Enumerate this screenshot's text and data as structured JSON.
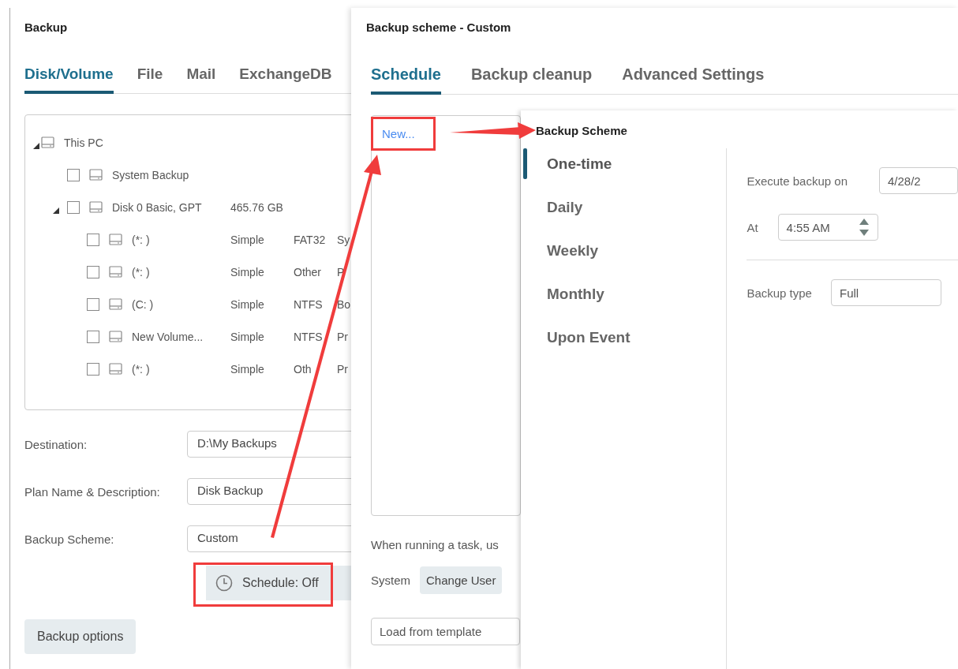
{
  "backup_window": {
    "title": "Backup",
    "tabs": [
      {
        "label": "Disk/Volume",
        "selected": true
      },
      {
        "label": "File",
        "selected": false
      },
      {
        "label": "Mail",
        "selected": false
      },
      {
        "label": "ExchangeDB",
        "selected": false
      }
    ],
    "tree": [
      {
        "cells": [
          "This PC"
        ],
        "expanded": true,
        "children": [
          {
            "cells": [
              "System Backup"
            ],
            "checked": false
          },
          {
            "cells": [
              "Disk 0 Basic, GPT",
              "465.76 GB"
            ],
            "checked": false,
            "expanded": true,
            "children": [
              {
                "cells": [
                  "(*: )",
                  "Simple",
                  "FAT32",
                  "Sy"
                ],
                "checked": false
              },
              {
                "cells": [
                  "(*: )",
                  "Simple",
                  "Other",
                  "P"
                ],
                "checked": false
              },
              {
                "cells": [
                  "(C: )",
                  "Simple",
                  "NTFS",
                  "Bo"
                ],
                "checked": false
              },
              {
                "cells": [
                  "New Volume...",
                  "Simple",
                  "NTFS",
                  "Pr"
                ],
                "checked": false
              },
              {
                "cells": [
                  "(*: )",
                  "Simple",
                  "Oth",
                  "Pr"
                ],
                "checked": false
              }
            ]
          }
        ]
      }
    ],
    "fields": [
      {
        "label": "Destination:",
        "value": "D:\\My Backups"
      },
      {
        "label": "Plan Name & Description:",
        "value": "Disk Backup"
      },
      {
        "label": "Backup Scheme:",
        "value": "Custom"
      }
    ],
    "schedule_button": "Schedule: Off",
    "options_button": "Backup options"
  },
  "scheme_window": {
    "title": "Backup scheme - Custom",
    "tabs": [
      {
        "label": "Schedule",
        "selected": true
      },
      {
        "label": "Backup cleanup",
        "selected": false
      },
      {
        "label": "Advanced Settings",
        "selected": false
      }
    ],
    "new_link": "New...",
    "run_as_label": "When running a task, us",
    "user": "System",
    "change_user_button": "Change User",
    "template_field": {
      "value": "Load from template"
    }
  },
  "scheme_panel": {
    "title": "Backup Scheme",
    "frequencies": [
      {
        "label": "One-time",
        "selected": true
      },
      {
        "label": "Daily",
        "selected": false
      },
      {
        "label": "Weekly",
        "selected": false
      },
      {
        "label": "Monthly",
        "selected": false
      },
      {
        "label": "Upon Event",
        "selected": false
      }
    ],
    "execute_label": "Execute backup on",
    "execute_date": "4/28/2",
    "at_label": "At",
    "time": "4:55 AM",
    "type_label": "Backup type",
    "type_value": "Full"
  }
}
